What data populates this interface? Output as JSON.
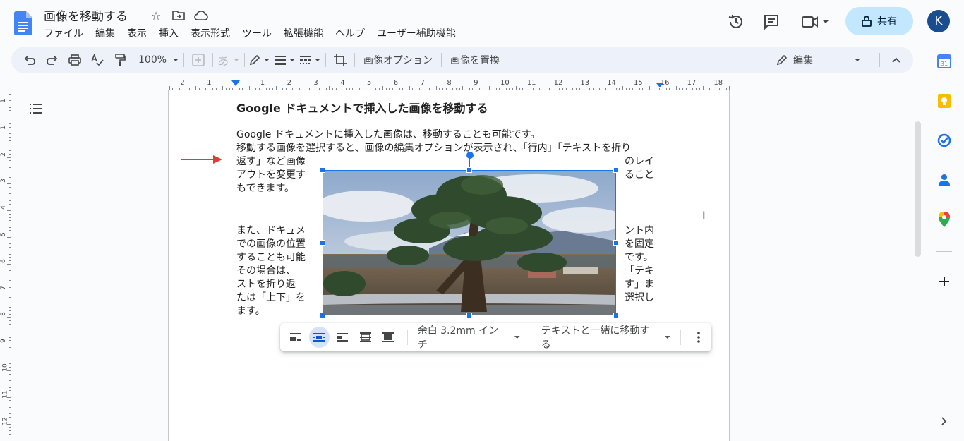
{
  "doc": {
    "title": "画像を移動する"
  },
  "menu": [
    "ファイル",
    "編集",
    "表示",
    "挿入",
    "表示形式",
    "ツール",
    "拡張機能",
    "ヘルプ",
    "ユーザー補助機能"
  ],
  "header": {
    "share_label": "共有",
    "avatar_letter": "K"
  },
  "toolbar": {
    "zoom": "100%",
    "font_placeholder": "あ",
    "image_options": "画像オプション",
    "replace_image": "画像を置換",
    "mode_label": "編集"
  },
  "ruler": {
    "h_labels": [
      "2",
      "1",
      "1",
      "2",
      "3",
      "4",
      "5",
      "6",
      "7",
      "8",
      "9",
      "10",
      "11",
      "12",
      "13",
      "14",
      "15",
      "16",
      "17",
      "18"
    ],
    "v_labels": [
      "1",
      "1",
      "2",
      "3",
      "4",
      "5",
      "6",
      "7",
      "8",
      "9",
      "10",
      "11",
      "12"
    ]
  },
  "content": {
    "heading": "Google ドキュメントで挿入した画像を移動する",
    "line1": "Google ドキュメントに挿入した画像は、移動することも可能です。",
    "line2": "移動する画像を選択すると、画像の編集オプションが表示され、「行内」「テキストを折り",
    "left_lines_a": [
      "返す」など画像",
      "アウトを変更す",
      "もできます。"
    ],
    "right_lines_a": [
      "のレイ",
      "ること"
    ],
    "left_lines_b": [
      "また、ドキュメ",
      "での画像の位置",
      "することも可能",
      "その場合は、",
      "ストを折り返",
      "たは「上下」を",
      "ます。"
    ],
    "right_lines_b": [
      "ント内",
      "を固定",
      "です。",
      "「テキ",
      "す」ま",
      "選択し"
    ]
  },
  "image_toolbar": {
    "margin_label": "余白 3.2mm インチ",
    "position_label": "テキストと一緒に移動する"
  },
  "colors": {
    "accent": "#1a73e8",
    "share_bg": "#c2e7ff",
    "toolbar_bg": "#edf2fa",
    "arrow": "#e53935"
  }
}
